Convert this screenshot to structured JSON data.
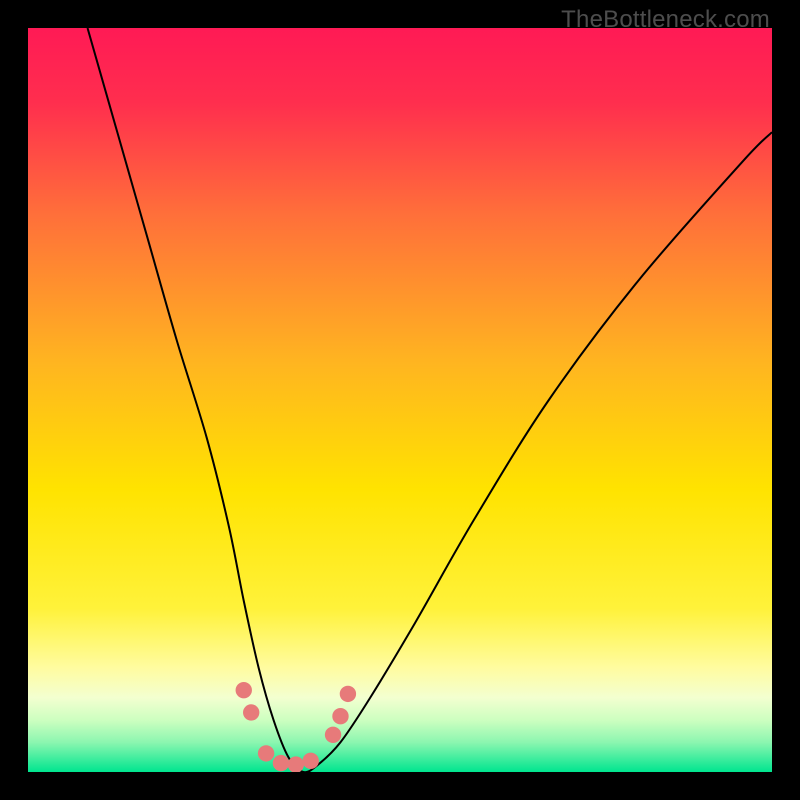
{
  "watermark": "TheBottleneck.com",
  "chart_data": {
    "type": "line",
    "title": "",
    "xlabel": "",
    "ylabel": "",
    "xlim": [
      0,
      100
    ],
    "ylim": [
      0,
      100
    ],
    "background_gradient": {
      "top": "#ff1a4d",
      "mid1": "#ff8a2b",
      "mid2": "#ffe400",
      "mid3": "#fff98a",
      "bottom_band": "#e8ffb3",
      "bottom": "#00e891"
    },
    "series": [
      {
        "name": "bottleneck-curve",
        "color": "#000000",
        "x": [
          8,
          12,
          16,
          20,
          24,
          27,
          29,
          31,
          33,
          35,
          37,
          39,
          42,
          46,
          52,
          60,
          70,
          82,
          96,
          100
        ],
        "values": [
          100,
          86,
          72,
          58,
          45,
          33,
          23,
          14,
          7,
          2,
          0,
          1,
          4,
          10,
          20,
          34,
          50,
          66,
          82,
          86
        ]
      }
    ],
    "markers": {
      "name": "highlight-points",
      "color": "#e77a7a",
      "radius_pct": 1.1,
      "points": [
        {
          "x": 29.0,
          "y": 11.0
        },
        {
          "x": 30.0,
          "y": 8.0
        },
        {
          "x": 32.0,
          "y": 2.5
        },
        {
          "x": 34.0,
          "y": 1.2
        },
        {
          "x": 36.0,
          "y": 1.0
        },
        {
          "x": 38.0,
          "y": 1.5
        },
        {
          "x": 41.0,
          "y": 5.0
        },
        {
          "x": 42.0,
          "y": 7.5
        },
        {
          "x": 43.0,
          "y": 10.5
        }
      ]
    }
  }
}
